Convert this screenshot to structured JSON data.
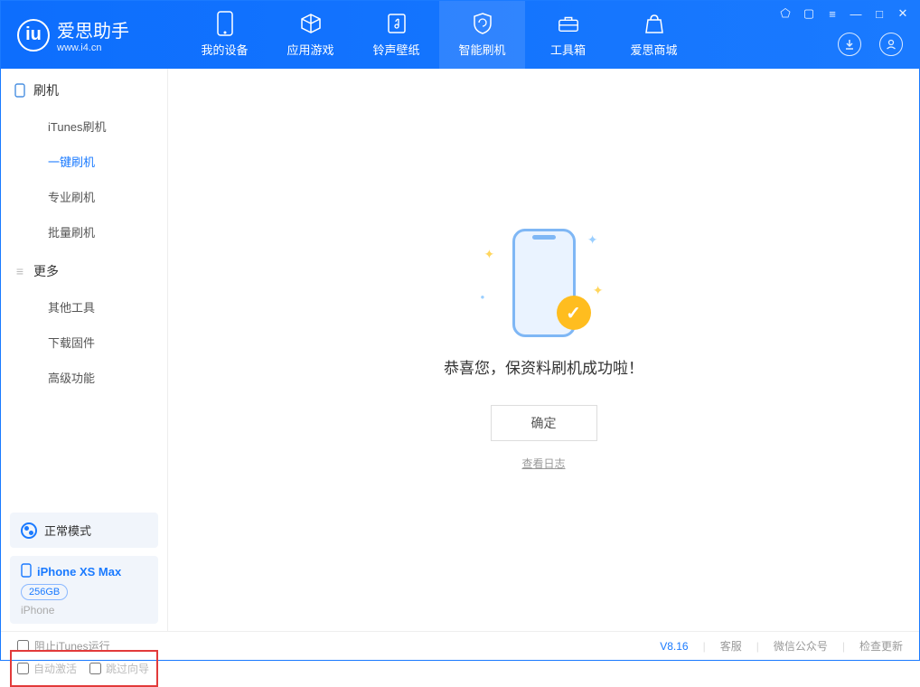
{
  "app": {
    "name": "爱思助手",
    "url": "www.i4.cn"
  },
  "nav": [
    {
      "label": "我的设备"
    },
    {
      "label": "应用游戏"
    },
    {
      "label": "铃声壁纸"
    },
    {
      "label": "智能刷机"
    },
    {
      "label": "工具箱"
    },
    {
      "label": "爱思商城"
    }
  ],
  "sidebar": {
    "section1": "刷机",
    "items1": [
      {
        "label": "iTunes刷机"
      },
      {
        "label": "一键刷机"
      },
      {
        "label": "专业刷机"
      },
      {
        "label": "批量刷机"
      }
    ],
    "section2": "更多",
    "items2": [
      {
        "label": "其他工具"
      },
      {
        "label": "下载固件"
      },
      {
        "label": "高级功能"
      }
    ],
    "mode": "正常模式",
    "device": {
      "name": "iPhone XS Max",
      "storage": "256GB",
      "type": "iPhone"
    },
    "options": {
      "auto_activate": "自动激活",
      "skip_wizard": "跳过向导"
    }
  },
  "main": {
    "success_message": "恭喜您，保资料刷机成功啦！",
    "ok_button": "确定",
    "view_log": "查看日志"
  },
  "footer": {
    "block_itunes": "阻止iTunes运行",
    "version": "V8.16",
    "support": "客服",
    "wechat": "微信公众号",
    "check_update": "检查更新"
  }
}
